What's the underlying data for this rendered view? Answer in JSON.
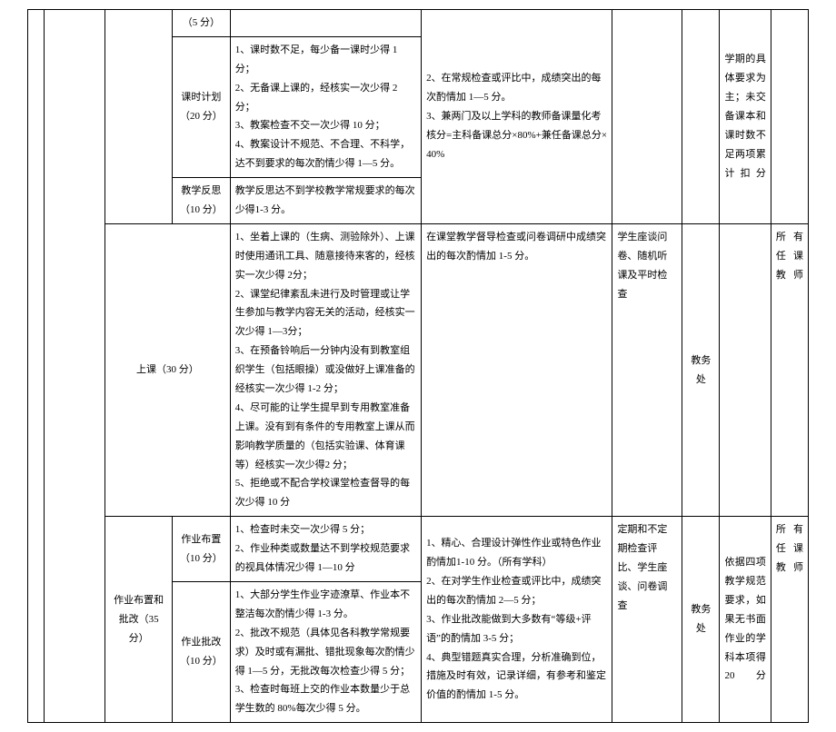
{
  "row_top": {
    "sub": "（5 分）",
    "bonus": "2、在常规检查或评比中，成绩突出的每次酌情加 1—5 分。\n3、兼两门及以上学科的教师备课量化考核分=主科备课总分×80%+兼任备课总分×40%",
    "note": "学期的具体要求为主；未交备课本和课时数不足两项累计扣分"
  },
  "row_plan": {
    "sub": "课时计划（20 分）",
    "ded": "1、课时数不足，每少备一课时少得 1 分；\n2、无备课上课的，经核实一次少得 2 分；\n3、教案检查不交一次少得 10 分；\n4、教案设计不规范、不合理、不科学，达不到要求的每次酌情少得 1—5 分。"
  },
  "row_reflect": {
    "sub": "教学反思（10 分）",
    "ded": "教学反思达不到学校教学常规要求的每次少得1-3 分。"
  },
  "row_class": {
    "cat": "上课（30 分）",
    "ded": "1、坐着上课的（生病、测验除外）、上课时使用通讯工具、随意接待来客的，经核实一次少得 2分；\n2、课堂纪律紊乱未进行及时管理或让学生参加与教学内容无关的活动，经核实一次少得 1—3分；\n3、在预备铃响后一分钟内没有到教室组织学生（包括眼操）或没做好上课准备的经核实一次少得 1-2 分；\n4、尽可能的让学生提早到专用教室准备上课。没有到有条件的专用教室上课从而影响教学质量的（包括实验课、体育课等）经核实一次少得2 分；\n5、拒绝或不配合学校课堂检查督导的每次少得 10 分",
    "bonus": "在课堂教学督导检查或问卷调研中成绩突出的每次酌情加 1-5 分。",
    "meth": "学生座谈问卷、随机听课及平时检查",
    "dept": "教务处",
    "scope": "所有任课教师"
  },
  "row_hw": {
    "cat": "作业布置和批改（35 分）",
    "assign_sub": "作业布置（10 分）",
    "assign_ded": "1、检查时未交一次少得 5 分；\n2、作业种类或数量达不到学校规范要求的视具体情况少得 1—10 分",
    "correct_sub": "作业批改（10 分）",
    "correct_ded": "1、大部分学生作业字迹潦草、作业本不整洁每次酌情少得 1-3 分。\n2、批改不规范（具体见各科教学常规要求）及时或有漏批、错批现象每次酌情少得 1—5 分，无批改每次检查少得 5 分；\n3、检查时每班上交的作业本数量少于总学生数的 80%每次少得 5 分。",
    "bonus": "1、精心、合理设计弹性作业或特色作业酌情加1-10 分。（所有学科）\n2、在对学生作业检查或评比中，成绩突出的每次酌情加 2—5 分；\n3、作业批改能做到大多数有“等级+评语”的酌情加 3-5 分；\n4、典型错题真实合理，分析准确到位，措施及时有效，记录详细，有参考和鉴定价值的酌情加 1-5 分。",
    "meth": "定期和不定期检查评比、学生座谈、问卷调查",
    "dept": "教务处",
    "note": "依据四项教学规范要求，如果无书面作业的学科本项得 20分",
    "scope": "所有任课教师"
  }
}
